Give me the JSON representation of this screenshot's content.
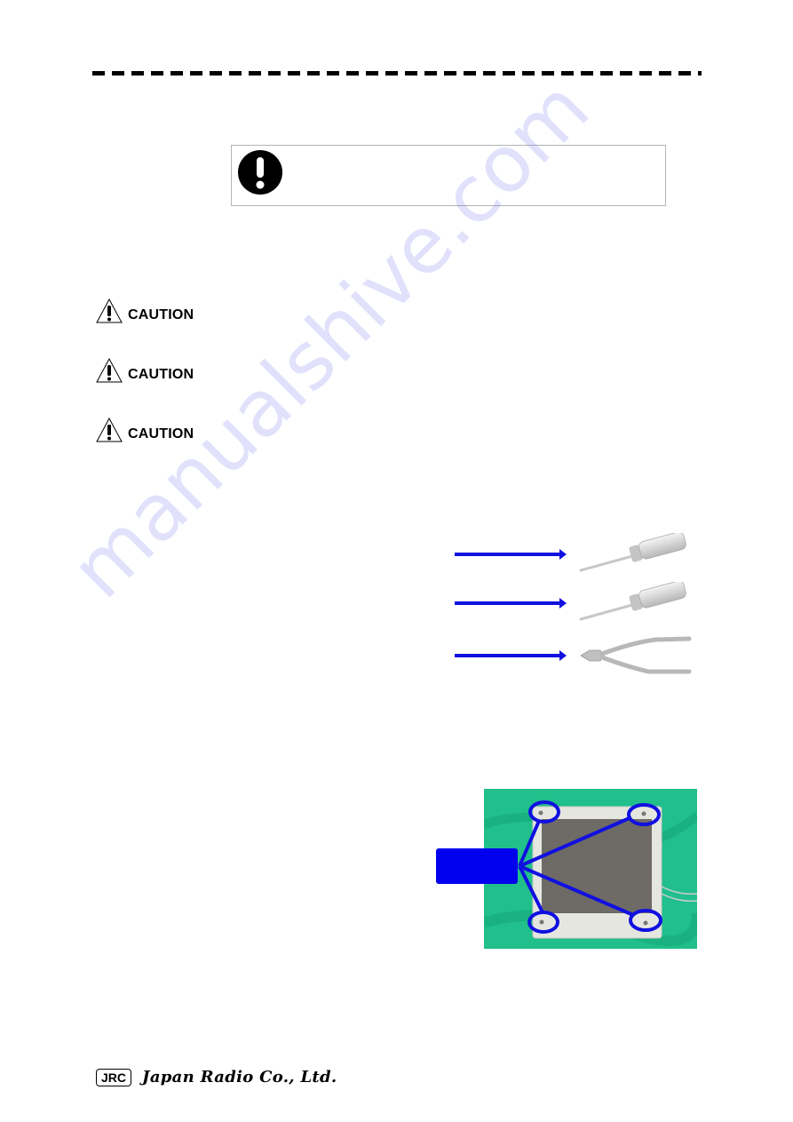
{
  "watermark": "manualshive.com",
  "notice": {
    "icon": "mandatory-action-icon",
    "text": ""
  },
  "cautions": [
    {
      "icon": "warning-triangle-icon",
      "label": "CAUTION",
      "text": ""
    },
    {
      "icon": "warning-triangle-icon",
      "label": "CAUTION",
      "text": ""
    },
    {
      "icon": "warning-triangle-icon",
      "label": "CAUTION",
      "text": ""
    }
  ],
  "tools": [
    {
      "name": "screwdriver",
      "label": ""
    },
    {
      "name": "screwdriver",
      "label": ""
    },
    {
      "name": "nippers",
      "label": ""
    }
  ],
  "photo": {
    "subject": "LCD monitor front with four corner screws circled",
    "callout_label": ""
  },
  "footer": {
    "logo_mark": "JRC",
    "company_name": "Japan Radio Co., Ltd."
  },
  "colors": {
    "accent_blue": "#1010e0",
    "callout_blue": "#0000ee",
    "photo_background": "#1fbf8a"
  }
}
